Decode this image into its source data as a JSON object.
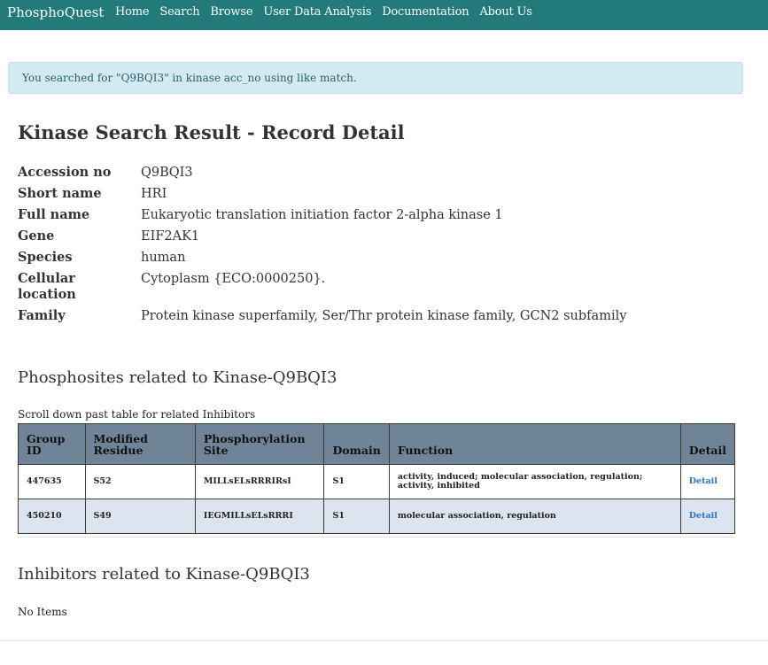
{
  "navbar": {
    "brand": "PhosphoQuest",
    "links": [
      "Home",
      "Search",
      "Browse",
      "User Data Analysis",
      "Documentation",
      "About Us"
    ]
  },
  "alert": {
    "text": "You searched for \"Q9BQI3\" in kinase acc_no using like match."
  },
  "page_title": "Kinase Search Result - Record Detail",
  "details": [
    {
      "label": "Accession no",
      "value": "Q9BQI3"
    },
    {
      "label": "Short name",
      "value": "HRI"
    },
    {
      "label": "Full name",
      "value": "Eukaryotic translation initiation factor 2-alpha kinase 1"
    },
    {
      "label": "Gene",
      "value": "EIF2AK1"
    },
    {
      "label": "Species",
      "value": "human"
    },
    {
      "label": "Cellular location",
      "value": "Cytoplasm {ECO:0000250}."
    },
    {
      "label": "Family",
      "value": "Protein kinase superfamily, Ser/Thr protein kinase family, GCN2 subfamily"
    }
  ],
  "phosphosites": {
    "heading": "Phosphosites related to Kinase-Q9BQI3",
    "note": "Scroll down past table for related Inhibitors",
    "columns": [
      "Group ID",
      "Modified Residue",
      "Phosphorylation Site",
      "Domain",
      "Function",
      "Detail"
    ],
    "rows": [
      {
        "group_id": "447635",
        "residue": "S52",
        "site": "MILLsELsRRRIRsI",
        "domain": "S1",
        "function": "activity, induced; molecular association, regulation; activity, inhibited",
        "detail": "Detail"
      },
      {
        "group_id": "450210",
        "residue": "S49",
        "site": "IEGMILLsELsRRRI",
        "domain": "S1",
        "function": "molecular association, regulation",
        "detail": "Detail"
      }
    ]
  },
  "inhibitors": {
    "heading": "Inhibitors related to Kinase-Q9BQI3",
    "empty_text": "No Items"
  }
}
